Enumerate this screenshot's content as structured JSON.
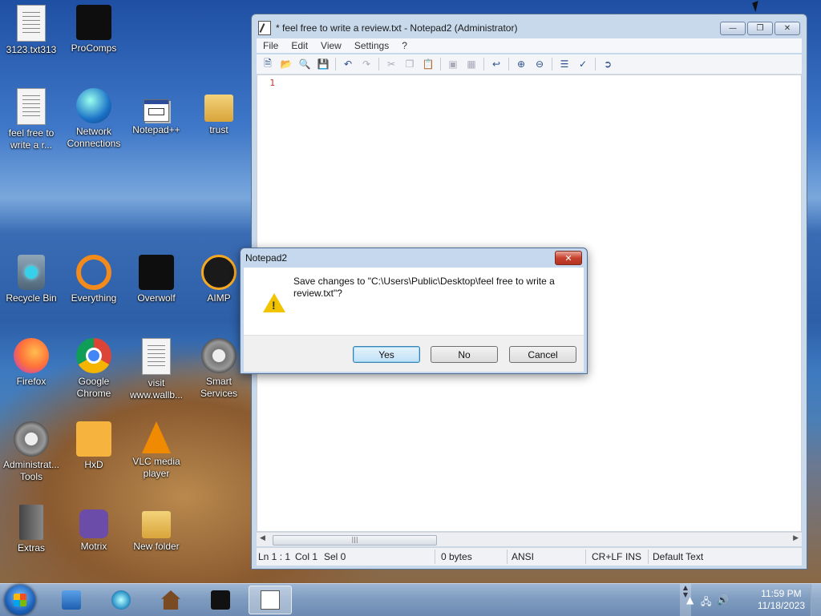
{
  "desktop": {
    "icons": [
      {
        "label": "3123.txt313"
      },
      {
        "label": "ProComps"
      },
      {
        "label": "feel free to write a r..."
      },
      {
        "label": "Network Connections"
      },
      {
        "label": "Notepad++"
      },
      {
        "label": "trust"
      },
      {
        "label": "Recycle Bin"
      },
      {
        "label": "Everything"
      },
      {
        "label": "Overwolf"
      },
      {
        "label": "AIMP"
      },
      {
        "label": "Firefox"
      },
      {
        "label": "Google Chrome"
      },
      {
        "label": "visit www.wallb..."
      },
      {
        "label": "Smart Services"
      },
      {
        "label": "Administrat... Tools"
      },
      {
        "label": "HxD"
      },
      {
        "label": "VLC media player"
      },
      {
        "label": "Extras"
      },
      {
        "label": "Motrix"
      },
      {
        "label": "New folder"
      }
    ]
  },
  "notepad": {
    "title": "* feel free to write a review.txt - Notepad2 (Administrator)",
    "menu": [
      "File",
      "Edit",
      "View",
      "Settings",
      "?"
    ],
    "line_number": "1",
    "status": {
      "position": "Ln 1 : 1",
      "col": "Col 1",
      "sel": "Sel 0",
      "size": "0 bytes",
      "encoding": "ANSI",
      "eol": "CR+LF",
      "mode": "INS",
      "scheme": "Default Text"
    }
  },
  "dialog": {
    "title": "Notepad2",
    "message": "Save changes to \"C:\\Users\\Public\\Desktop\\feel free to write a review.txt\"?",
    "buttons": {
      "yes": "Yes",
      "no": "No",
      "cancel": "Cancel"
    }
  },
  "taskbar": {
    "time": "11:59 PM",
    "date": "11/18/2023"
  }
}
